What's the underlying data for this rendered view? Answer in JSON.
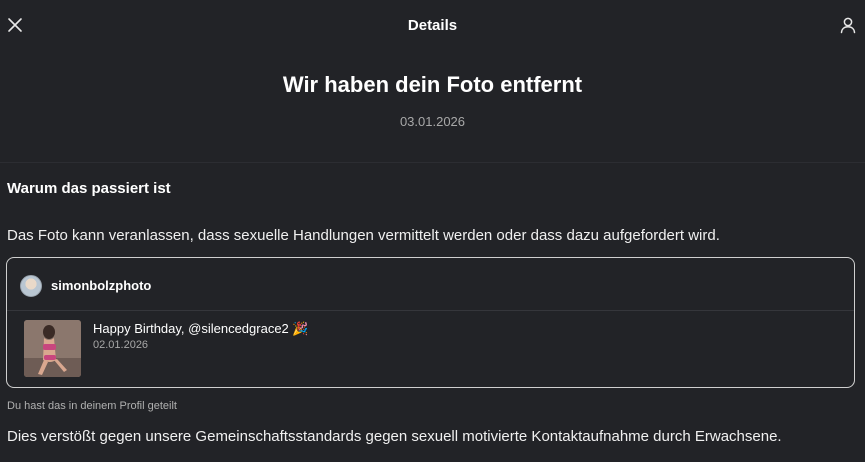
{
  "header": {
    "title": "Details",
    "close_icon": "close-icon",
    "profile_icon": "person-icon"
  },
  "notice": {
    "title": "Wir haben dein Foto entfernt",
    "date": "03.01.2026"
  },
  "reason": {
    "heading": "Warum das passiert ist",
    "text": "Das Foto kann veranlassen, dass sexuelle Handlungen vermittelt werden oder dass dazu aufgefordert wird."
  },
  "post": {
    "username": "simonbolzphoto",
    "caption": "Happy Birthday, @silencedgrace2 🎉",
    "date": "02.01.2026"
  },
  "shared_note": "Du hast das in deinem Profil geteilt",
  "violation_text": "Dies verstößt gegen unsere Gemeinschaftsstandards gegen sexuell motivierte Kontaktaufnahme durch Erwachsene."
}
